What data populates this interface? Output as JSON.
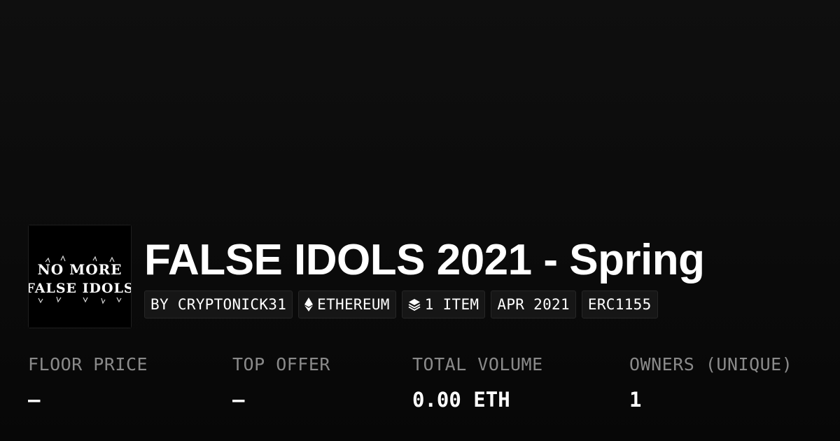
{
  "collection": {
    "image_text_line1": "NO MORE",
    "image_text_line2": "FALSE IDOLS",
    "title": "FALSE IDOLS 2021 - Spring"
  },
  "chips": {
    "creator": "BY CRYPTONICK31",
    "chain": "ETHEREUM",
    "items": "1 ITEM",
    "date": "APR 2021",
    "standard": "ERC1155"
  },
  "icons": {
    "chain": "ethereum-icon",
    "items": "layers-icon"
  },
  "stats": {
    "floor_price_label": "FLOOR PRICE",
    "floor_price_value": "–",
    "top_offer_label": "TOP OFFER",
    "top_offer_value": "–",
    "total_volume_label": "TOTAL VOLUME",
    "total_volume_value": "0.00 ETH",
    "owners_label": "OWNERS (UNIQUE)",
    "owners_value": "1"
  },
  "colors": {
    "background": "#0b0b0b",
    "chip_background": "#161616",
    "label_gray": "#8a8a8a",
    "text": "#ffffff"
  }
}
